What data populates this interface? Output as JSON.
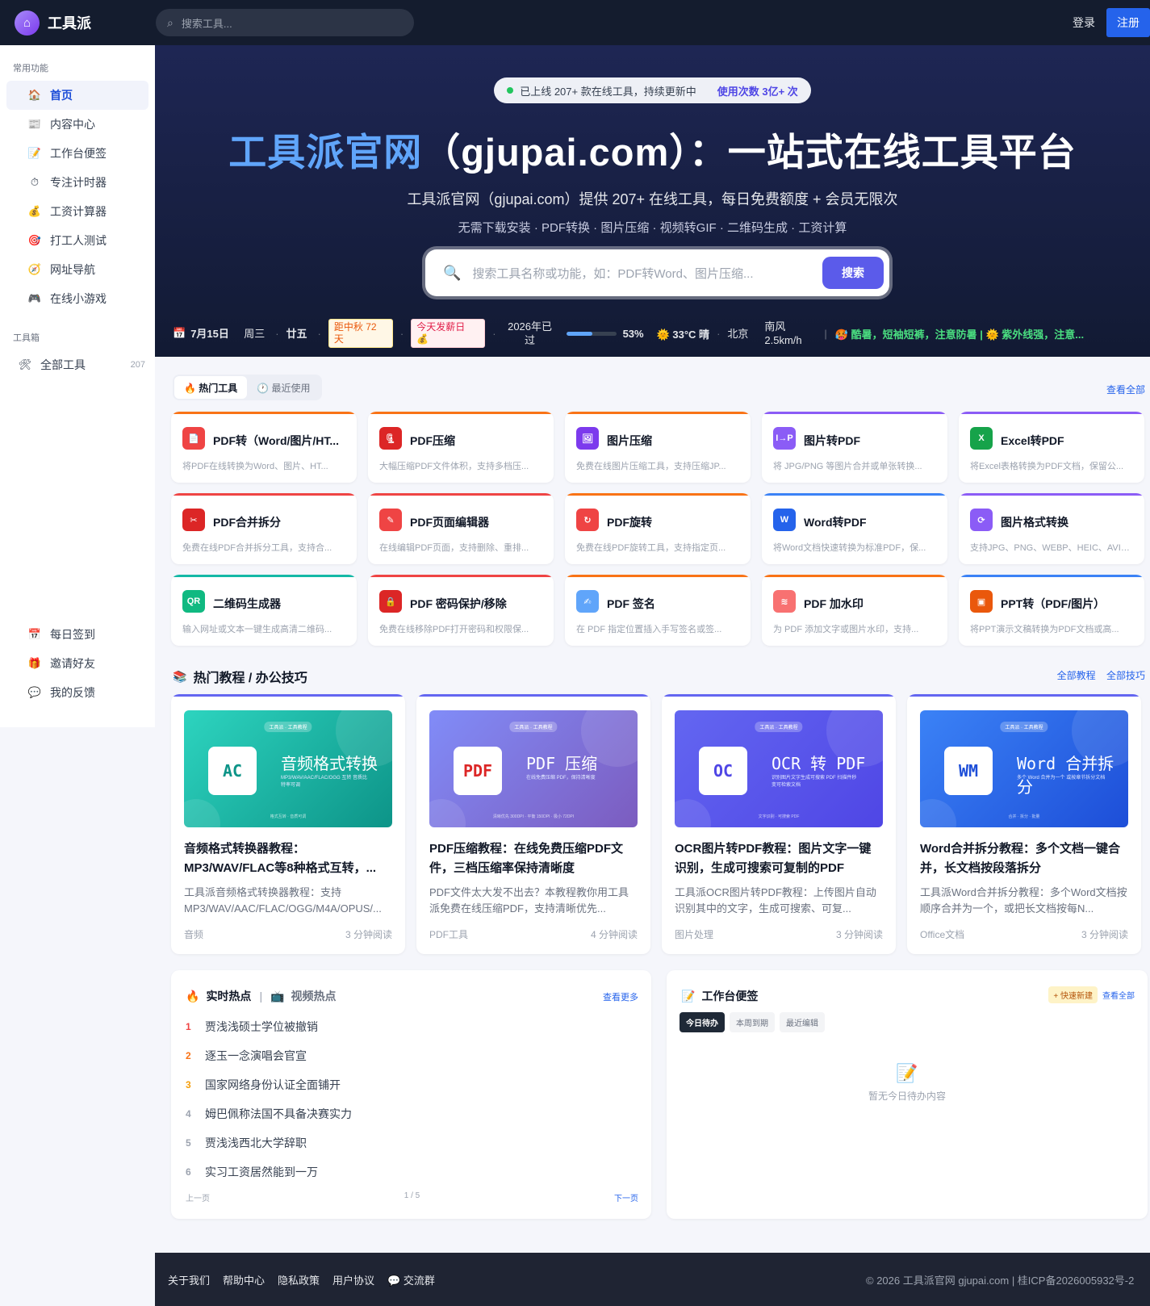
{
  "topbar": {
    "logo": "工具派",
    "search_placeholder": "搜索工具...",
    "login": "登录",
    "register": "注册"
  },
  "sidebar": {
    "section1": "常用功能",
    "items": [
      {
        "icon": "🏠",
        "label": "首页",
        "active": true
      },
      {
        "icon": "📰",
        "label": "内容中心"
      },
      {
        "icon": "📝",
        "label": "工作台便签"
      },
      {
        "icon": "⏱",
        "label": "专注计时器"
      },
      {
        "icon": "💰",
        "label": "工资计算器"
      },
      {
        "icon": "🎯",
        "label": "打工人测试"
      },
      {
        "icon": "🧭",
        "label": "网址导航"
      },
      {
        "icon": "🎮",
        "label": "在线小游戏"
      }
    ],
    "section2": "工具箱",
    "all_tools": {
      "icon": "🛠",
      "label": "全部工具",
      "count": "207"
    },
    "bottom": [
      {
        "icon": "📅",
        "label": "每日签到"
      },
      {
        "icon": "🎁",
        "label": "邀请好友"
      },
      {
        "icon": "💬",
        "label": "我的反馈"
      }
    ]
  },
  "hero": {
    "pill_text": "已上线 207+ 款在线工具，持续更新中",
    "pill_uses": "使用次数 3亿+ 次",
    "title_hl": "工具派官网",
    "title_rest": "（gjupai.com）：一站式在线工具平台",
    "subtitle": "工具派官网（gjupai.com）提供 207+ 在线工具，每日免费额度 + 会员无限次",
    "subtitle2": "无需下载安装 · PDF转换 · 图片压缩 · 视频转GIF · 二维码生成 · 工资计算",
    "search_placeholder": "搜索工具名称或功能，如：PDF转Word、图片压缩...",
    "search_button": "搜索"
  },
  "infobar": {
    "date": "7月15日",
    "week": "周三",
    "lunar": "廿五",
    "festival": "距中秋 72 天",
    "payday": "今天发薪日 💰",
    "year_text": "2026年已过",
    "year_progress": 0.53,
    "year_pct": "53%",
    "weather": "🌞 33°C 晴",
    "city": "北京",
    "wind": "南风 2.5km/h",
    "warning": "🥵 酷暑，短袖短裤，注意防暑 | 🌞 紫外线强，注意..."
  },
  "tools_tabs": {
    "hot": "🔥 热门工具",
    "recent": "🕐 最近使用",
    "view_all": "查看全部"
  },
  "tools": [
    {
      "name": "PDF转（Word/图片/HT...",
      "desc": "将PDF在线转换为Word、图片、HT...",
      "color": "#ef4444",
      "bar": "#f97316",
      "glyph": "📄"
    },
    {
      "name": "PDF压缩",
      "desc": "大幅压缩PDF文件体积，支持多档压...",
      "color": "#dc2626",
      "bar": "#f97316",
      "glyph": "🗜"
    },
    {
      "name": "图片压缩",
      "desc": "免费在线图片压缩工具，支持压缩JP...",
      "color": "#7c3aed",
      "bar": "#f97316",
      "glyph": "🖼"
    },
    {
      "name": "图片转PDF",
      "desc": "将 JPG/PNG 等图片合并或单张转换...",
      "color": "#8b5cf6",
      "bar": "#8b5cf6",
      "glyph": "I→P"
    },
    {
      "name": "Excel转PDF",
      "desc": "将Excel表格转换为PDF文档，保留公...",
      "color": "#16a34a",
      "bar": "#8b5cf6",
      "glyph": "X"
    },
    {
      "name": "PDF合并拆分",
      "desc": "免费在线PDF合并拆分工具，支持合...",
      "color": "#dc2626",
      "bar": "#ef4444",
      "glyph": "✂"
    },
    {
      "name": "PDF页面编辑器",
      "desc": "在线编辑PDF页面，支持删除、重排...",
      "color": "#ef4444",
      "bar": "#ef4444",
      "glyph": "✎"
    },
    {
      "name": "PDF旋转",
      "desc": "免费在线PDF旋转工具，支持指定页...",
      "color": "#ef4444",
      "bar": "#f97316",
      "glyph": "↻"
    },
    {
      "name": "Word转PDF",
      "desc": "将Word文档快速转换为标准PDF，保...",
      "color": "#2563eb",
      "bar": "#3b82f6",
      "glyph": "W"
    },
    {
      "name": "图片格式转换",
      "desc": "支持JPG、PNG、WEBP、HEIC、AVIF...",
      "color": "#8b5cf6",
      "bar": "#8b5cf6",
      "glyph": "⟳"
    },
    {
      "name": "二维码生成器",
      "desc": "输入网址或文本一键生成高清二维码...",
      "color": "#10b981",
      "bar": "#14b8a6",
      "glyph": "QR"
    },
    {
      "name": "PDF 密码保护/移除",
      "desc": "免费在线移除PDF打开密码和权限保...",
      "color": "#dc2626",
      "bar": "#ef4444",
      "glyph": "🔒"
    },
    {
      "name": "PDF 签名",
      "desc": "在 PDF 指定位置插入手写签名或签...",
      "color": "#60a5fa",
      "bar": "#f97316",
      "glyph": "✍"
    },
    {
      "name": "PDF 加水印",
      "desc": "为 PDF 添加文字或图片水印，支持...",
      "color": "#f87171",
      "bar": "#f97316",
      "glyph": "≋"
    },
    {
      "name": "PPT转（PDF/图片）",
      "desc": "将PPT演示文稿转换为PDF文档或高...",
      "color": "#ea580c",
      "bar": "#3b82f6",
      "glyph": "▣"
    }
  ],
  "tutorials_section": {
    "title": "热门教程 / 办公技巧",
    "link1": "全部教程",
    "link2": "全部技巧"
  },
  "tutorials": [
    {
      "badge": "工具派 · 工具教程",
      "icon_text": "AC",
      "big": "音频格式转换",
      "small": "MP3/WAV/AAC/FLAC/OGG 互转 音质比特率可调",
      "foot": "格式互转 · 音质可调",
      "bg": "linear-gradient(135deg,#2dd4bf,#0d9488)",
      "icolor": "#0d9488",
      "title": "音频格式转换器教程：MP3/WAV/FLAC等8种格式互转，...",
      "desc": "工具派音频格式转换器教程：支持MP3/WAV/AAC/FLAC/OGG/M4A/OPUS/...",
      "cat": "音频",
      "time": "3 分钟阅读"
    },
    {
      "badge": "工具派 · 工具教程",
      "icon_text": "PDF",
      "big": "PDF 压缩",
      "small": "在线免费压缩 PDF，保持清晰度",
      "foot": "清晰优先 300DPI · 平衡 150DPI · 极小 72DPI",
      "bg": "linear-gradient(135deg,#818cf8,#7c5cbf)",
      "icolor": "#dc2626",
      "title": "PDF压缩教程：在线免费压缩PDF文件，三档压缩率保持清晰度",
      "desc": "PDF文件太大发不出去？本教程教你用工具派免费在线压缩PDF，支持清晰优先...",
      "cat": "PDF工具",
      "time": "4 分钟阅读"
    },
    {
      "badge": "工具派 · 工具教程",
      "icon_text": "OC",
      "big": "OCR 转 PDF",
      "small": "识别图片文字生成可搜索 PDF 扫描件秒变可检索文档",
      "foot": "文字识别 · 可搜索 PDF",
      "bg": "linear-gradient(135deg,#6366f1,#4f46e5)",
      "icolor": "#4f46e5",
      "title": "OCR图片转PDF教程：图片文字一键识别，生成可搜索可复制的PDF",
      "desc": "工具派OCR图片转PDF教程：上传图片自动识别其中的文字，生成可搜索、可复...",
      "cat": "图片处理",
      "time": "3 分钟阅读"
    },
    {
      "badge": "工具派 · 工具教程",
      "icon_text": "WM",
      "big": "Word 合并拆分",
      "small": "多个 Word 合并为一个 或按章节拆分文档",
      "foot": "合并 · 拆分 · 批量",
      "bg": "linear-gradient(135deg,#3b82f6,#1d4ed8)",
      "icolor": "#1d4ed8",
      "title": "Word合并拆分教程：多个文档一键合并，长文档按段落拆分",
      "desc": "工具派Word合并拆分教程：多个Word文档按顺序合并为一个，或把长文档按每N...",
      "cat": "Office文档",
      "time": "3 分钟阅读"
    }
  ],
  "hot": {
    "title": "实时热点",
    "video": "视频热点",
    "more": "查看更多",
    "items": [
      {
        "rank": "1",
        "text": "贾浅浅硕士学位被撤销",
        "color": "#ef4444"
      },
      {
        "rank": "2",
        "text": "逐玉一念演唱会官宣",
        "color": "#f97316"
      },
      {
        "rank": "3",
        "text": "国家网络身份认证全面铺开",
        "color": "#f59e0b"
      },
      {
        "rank": "4",
        "text": "姆巴佩称法国不具备决赛实力",
        "color": "#9ca3af"
      },
      {
        "rank": "5",
        "text": "贾浅浅西北大学辞职",
        "color": "#9ca3af"
      },
      {
        "rank": "6",
        "text": "实习工资居然能到一万",
        "color": "#9ca3af"
      }
    ],
    "prev": "上一页",
    "page": "1 / 5",
    "next": "下一页"
  },
  "notes": {
    "title": "工作台便签",
    "new": "+ 快速新建",
    "all": "查看全部",
    "tabs": [
      "今日待办",
      "本周到期",
      "最近编辑"
    ],
    "empty": "暂无今日待办内容"
  },
  "footer": {
    "links": [
      "关于我们",
      "帮助中心",
      "隐私政策",
      "用户协议",
      "💬 交流群"
    ],
    "copyright": "© 2026 工具派官网 gjupai.com | 桂ICP备2026005932号-2"
  }
}
